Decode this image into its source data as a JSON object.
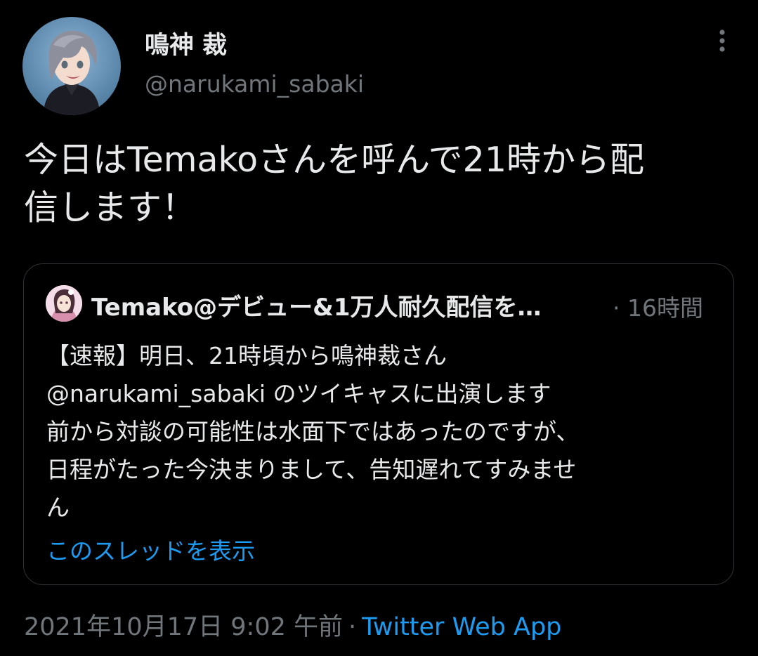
{
  "author": {
    "name": "鳴神 裁",
    "handle": "@narukami_sabaki"
  },
  "tweet": {
    "text_lines": [
      "今日はTemakoさんを呼んで21時から配",
      "信します！"
    ]
  },
  "quoted": {
    "name": "Temako@デビュー&1万人耐久配信を…",
    "time": "· 16時間",
    "lines": [
      "【速報】明日、21時頃から鳴神裁さん",
      "@narukami_sabaki のツイキャスに出演します",
      "前から対談の可能性は水面下ではあったのですが、",
      "日程がたった今決まりまして、告知遅れてすみませ",
      "ん"
    ],
    "thread_link": "このスレッドを表示"
  },
  "meta": {
    "timestamp": "2021年10月17日 9:02 午前",
    "separator": "·",
    "app": "Twitter Web App"
  },
  "icons": {
    "more": "more-vertical-icon"
  },
  "colors": {
    "background": "#000000",
    "text": "#e7e9ea",
    "muted": "#71767b",
    "link": "#1d9bf0",
    "border": "#2f3336"
  }
}
